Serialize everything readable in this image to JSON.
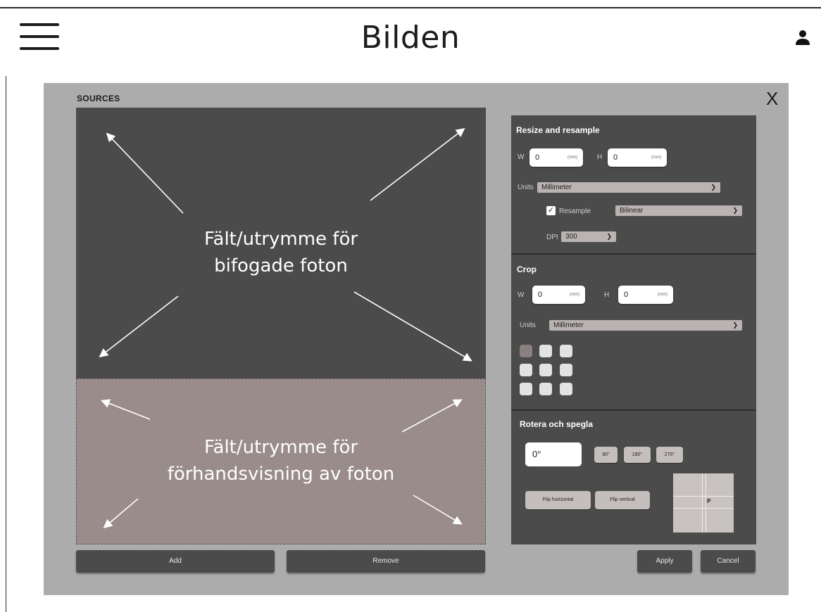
{
  "header": {
    "title": "Bilden"
  },
  "dialog": {
    "sources_label": "SOURCES",
    "close_label": "X",
    "photos_area_label_line1": "Fält/utrymme för",
    "photos_area_label_line2": "bifogade foton",
    "preview_area_label_line1": "Fält/utrymme för",
    "preview_area_label_line2": "förhandsvisning av foton",
    "add_label": "Add",
    "remove_label": "Remove",
    "apply_label": "Apply",
    "cancel_label": "Cancel"
  },
  "resize": {
    "title": "Resize and resample",
    "w_label": "W",
    "w_value": "0",
    "w_unit": "(mm)",
    "h_label": "H",
    "h_value": "0",
    "h_unit": "(mm)",
    "units_label": "Units",
    "units_value": "Millimeter",
    "resample_label": "Resample",
    "resample_checked": true,
    "resample_value": "Bilinear",
    "dpi_label": "DPI",
    "dpi_value": "300"
  },
  "crop": {
    "title": "Crop",
    "w_label": "W",
    "w_value": "0",
    "w_unit": "(mm)",
    "h_label": "H",
    "h_value": "0",
    "h_unit": "(mm)",
    "units_label": "Units",
    "units_value": "Millimeter",
    "anchor_selected": "top-left"
  },
  "rotate": {
    "title": "Rotera och spegla",
    "angle_value": "0°",
    "btn_90": "90°",
    "btn_180": "180°",
    "btn_270": "270°",
    "flip_h_label": "Flip horizontal",
    "flip_v_label": "Flip vertical",
    "preview_letter": "P"
  },
  "colors": {
    "dialog_bg": "#acacac",
    "panel_bg": "#4b4b4b",
    "preview_bg": "#9a8c8a"
  }
}
